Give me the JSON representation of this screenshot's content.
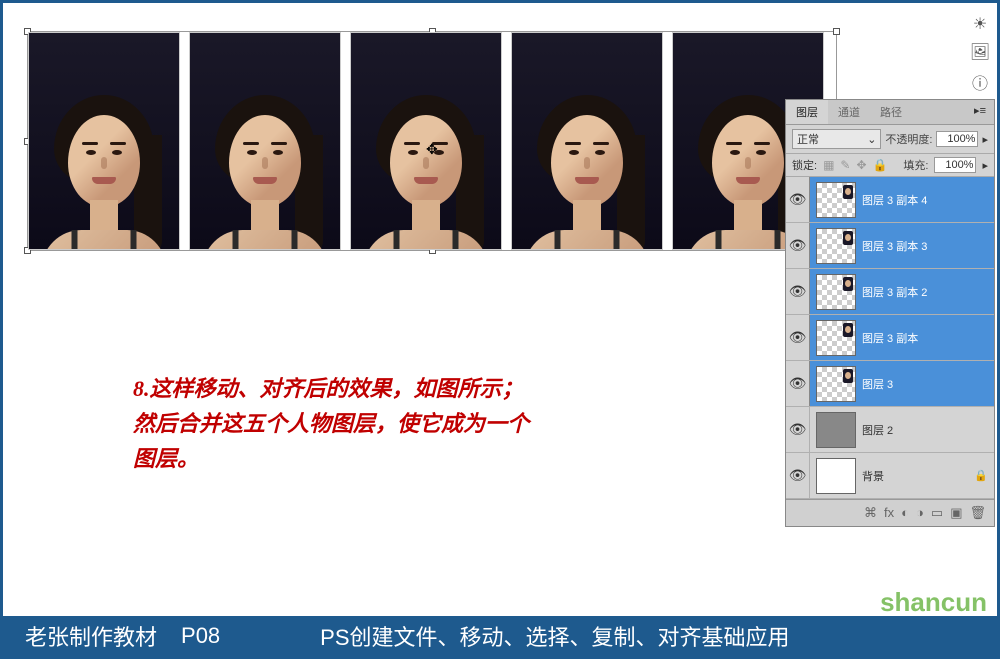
{
  "instruction": {
    "line1": "8.这样移动、对齐后的效果，如图所示；",
    "line2": "然后合并这五个人物图层，使它成为一个",
    "line3": "图层。"
  },
  "panel": {
    "tabs": [
      "图层",
      "通道",
      "路径"
    ],
    "active_tab": "图层",
    "blend_mode": "正常",
    "opacity_label": "不透明度:",
    "opacity_value": "100%",
    "lock_label": "锁定:",
    "fill_label": "填充:",
    "fill_value": "100%",
    "layers": [
      {
        "name": "图层 3 副本 4",
        "selected": true,
        "type": "trans-mini"
      },
      {
        "name": "图层 3 副本 3",
        "selected": true,
        "type": "trans-mini"
      },
      {
        "name": "图层 3 副本 2",
        "selected": true,
        "type": "trans-mini"
      },
      {
        "name": "图层 3 副本",
        "selected": true,
        "type": "trans-mini"
      },
      {
        "name": "图层 3",
        "selected": true,
        "type": "trans-mini"
      },
      {
        "name": "图层 2",
        "selected": false,
        "type": "grey"
      },
      {
        "name": "背景",
        "selected": false,
        "type": "white",
        "locked": true
      }
    ]
  },
  "footer": {
    "author": "老张制作教材",
    "page": "P08",
    "title": "PS创建文件、移动、选择、复制、对齐基础应用"
  },
  "watermark": "shancun"
}
